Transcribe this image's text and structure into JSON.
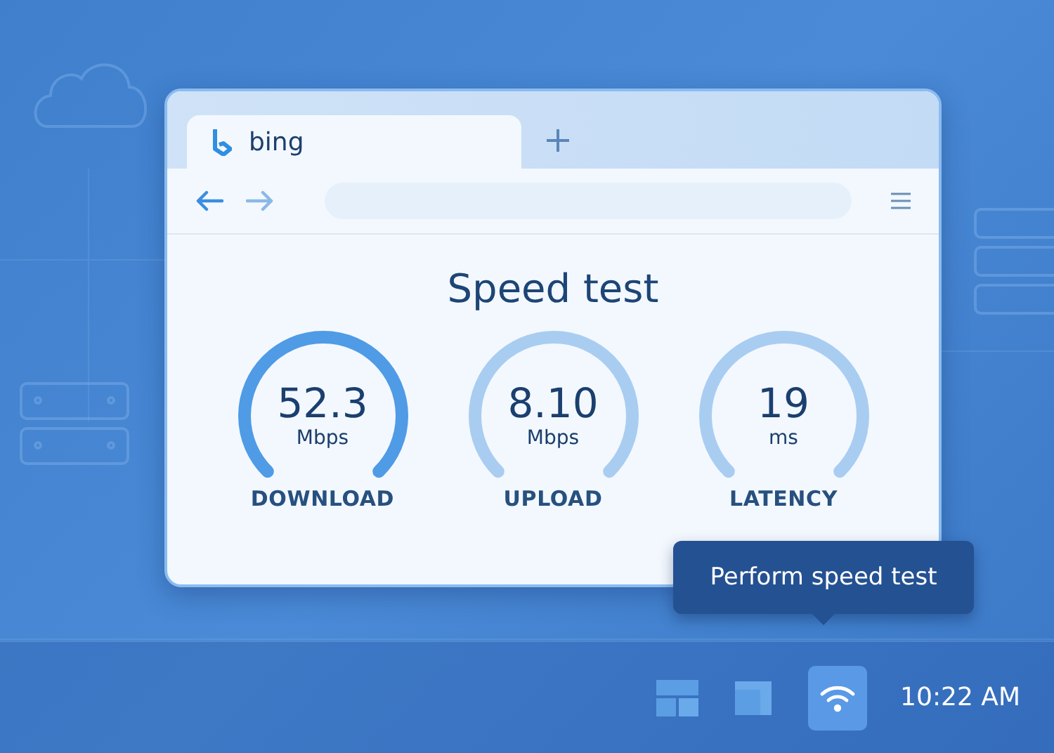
{
  "browser": {
    "tabs": [
      {
        "label": "bing",
        "selected": true
      }
    ],
    "page": {
      "title": "Speed test",
      "gauges": [
        {
          "value": "52.3",
          "unit": "Mbps",
          "label": "DOWNLOAD",
          "highlighted": true
        },
        {
          "value": "8.10",
          "unit": "Mbps",
          "label": "UPLOAD",
          "highlighted": false
        },
        {
          "value": "19",
          "unit": "ms",
          "label": "LATENCY",
          "highlighted": false
        }
      ]
    }
  },
  "tooltip": {
    "text": "Perform speed test"
  },
  "taskbar": {
    "items": [
      {
        "kind": "tiles",
        "selected": false
      },
      {
        "kind": "window",
        "selected": false
      },
      {
        "kind": "wifi",
        "selected": true
      }
    ],
    "clock": "10:22 AM"
  }
}
